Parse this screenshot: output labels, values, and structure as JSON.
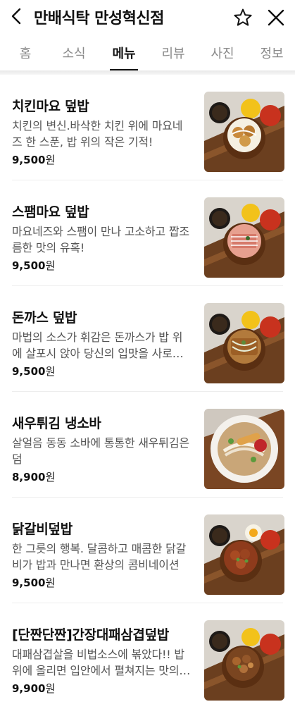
{
  "header": {
    "title": "만배식탁 만성혁신점"
  },
  "tabs": [
    {
      "label": "홈",
      "active": false
    },
    {
      "label": "소식",
      "active": false
    },
    {
      "label": "메뉴",
      "active": true
    },
    {
      "label": "리뷰",
      "active": false
    },
    {
      "label": "사진",
      "active": false
    },
    {
      "label": "정보",
      "active": false
    }
  ],
  "menu": [
    {
      "name": "치킨마요 덮밥",
      "description": "치킨의 변신.바삭한 치킨 위에 마요네즈 한 스푼, 밥 위의 작은 기적!",
      "price": "9,500",
      "currency": "원",
      "image": "chicken-mayo-bowl"
    },
    {
      "name": "스팸마요 덮밥",
      "description": "마요네즈와 스팸이 만나 고소하고 짭조름한 맛의 유혹!",
      "price": "9,500",
      "currency": "원",
      "image": "spam-mayo-bowl"
    },
    {
      "name": "돈까스 덮밥",
      "description": "마법의 소스가 휘감은 돈까스가 밥 위에 살포시 앉아 당신의 입맛을 사로잡습니다",
      "price": "9,500",
      "currency": "원",
      "image": "pork-cutlet-bowl"
    },
    {
      "name": "새우튀김 냉소바",
      "description": "살얼음 동동 소바에 통통한 새우튀김은 덤",
      "price": "8,900",
      "currency": "원",
      "image": "shrimp-cold-soba"
    },
    {
      "name": "닭갈비덮밥",
      "description": "한 그릇의 행복. 달콤하고 매콤한 닭갈비가 밥과 만나면 환상의 콤비네이션",
      "price": "9,500",
      "currency": "원",
      "image": "dakgalbi-bowl"
    },
    {
      "name": "[단짠단짠]간장대패삼겹덮밥",
      "description": "대패삼겹살을 비법소스에 볶았다!! 밥 위에 올리면 입안에서 펼쳐지는 맛의 향연",
      "price": "9,900",
      "currency": "원",
      "image": "soy-pork-belly-bowl"
    }
  ]
}
